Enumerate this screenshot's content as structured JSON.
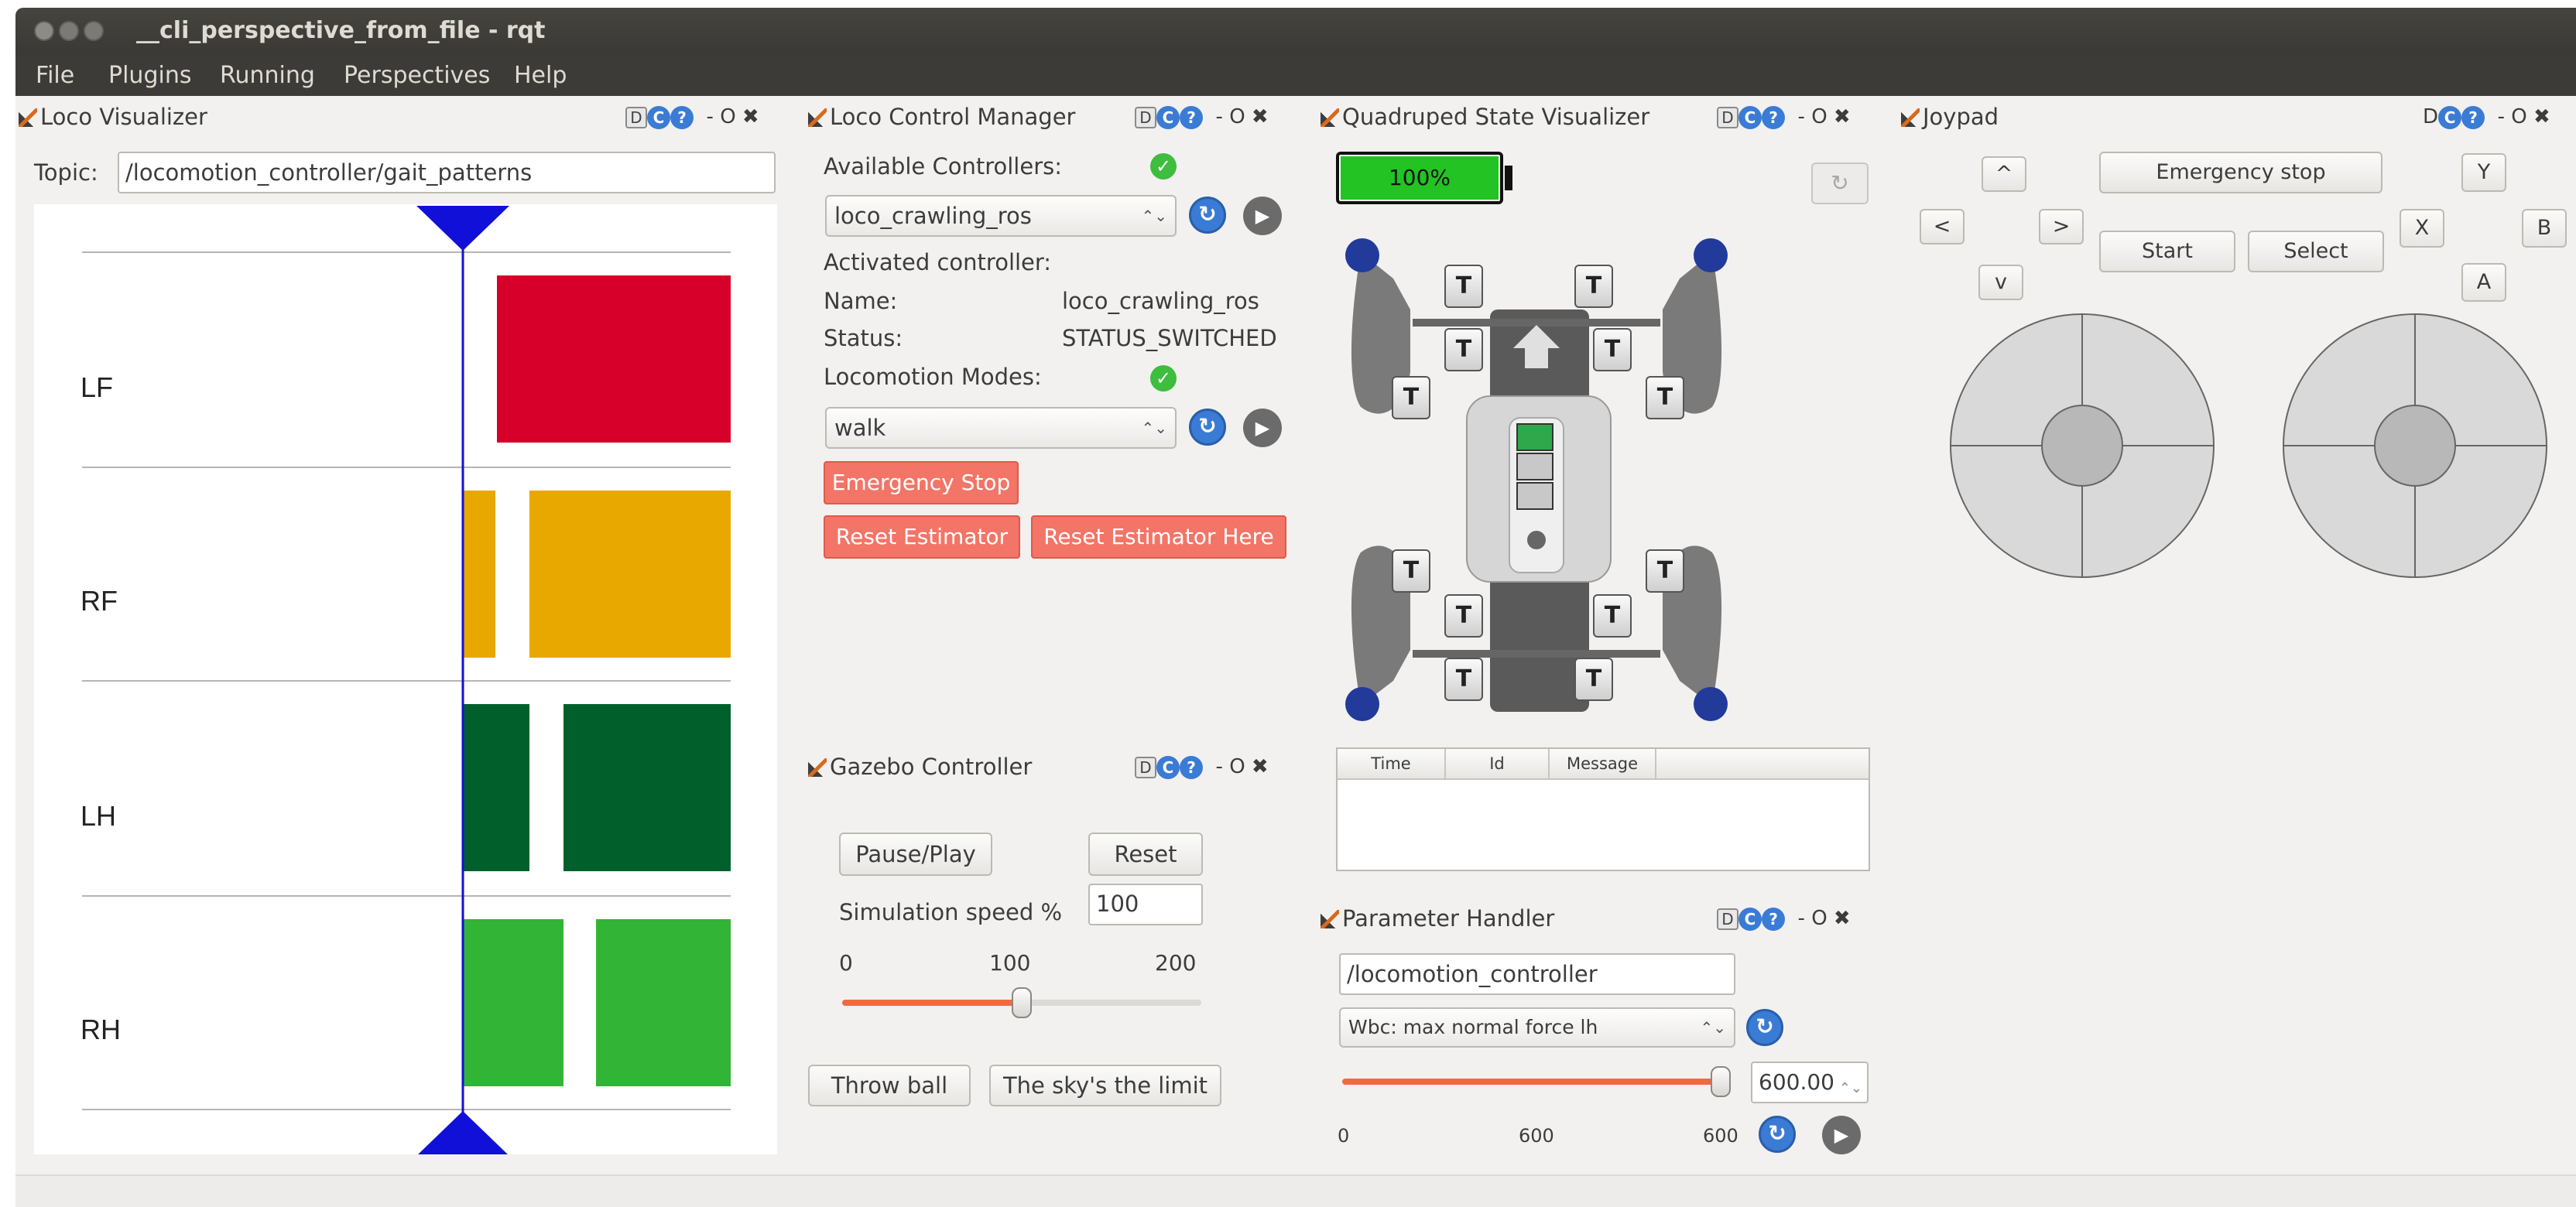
{
  "window": {
    "title": "__cli_perspective_from_file - rqt"
  },
  "menu": [
    "File",
    "Plugins",
    "Running",
    "Perspectives",
    "Help"
  ],
  "panel_controls": {
    "d": "D",
    "dash": "-",
    "o": "O",
    "x": "✖"
  },
  "colors": {
    "lf": "#d6002a",
    "rf": "#e8a800",
    "lh": "#005f2b",
    "rh": "#32b537",
    "cursor": "#1010d8",
    "red_button": "#f27567",
    "slider": "#ef6b3f"
  },
  "loco_visualizer": {
    "title": "Loco Visualizer",
    "topic_label": "Topic:",
    "topic_value": "/locomotion_controller/gait_patterns",
    "legs": [
      "LF",
      "RF",
      "LH",
      "RH"
    ]
  },
  "loco_control_manager": {
    "title": "Loco Control Manager",
    "available_label": "Available Controllers:",
    "controller_selected": "loco_crawling_ros",
    "activated_label": "Activated controller:",
    "name_label": "Name:",
    "name_value": "loco_crawling_ros",
    "status_label": "Status:",
    "status_value": "STATUS_SWITCHED",
    "modes_label": "Locomotion Modes:",
    "mode_selected": "walk",
    "emergency_stop": "Emergency Stop",
    "reset_estimator": "Reset Estimator",
    "reset_estimator_here": "Reset Estimator Here"
  },
  "quadruped_state": {
    "title": "Quadruped State Visualizer",
    "battery": "100%",
    "battery_level": 1.0,
    "leg_marker": "T",
    "table_headers": [
      "Time",
      "Id",
      "Message"
    ]
  },
  "joypad": {
    "title": "Joypad",
    "up": "^",
    "down": "v",
    "left": "<",
    "right": ">",
    "emergency_stop": "Emergency stop",
    "start": "Start",
    "select": "Select",
    "y": "Y",
    "x": "X",
    "b": "B",
    "a": "A"
  },
  "gazebo": {
    "title": "Gazebo Controller",
    "pause_play": "Pause/Play",
    "reset": "Reset",
    "speed_label": "Simulation speed %",
    "speed_value": "100",
    "tick_min": "0",
    "tick_mid": "100",
    "tick_max": "200",
    "slider_value": 100,
    "throw_ball": "Throw ball",
    "sky_limit": "The sky's the limit"
  },
  "parameter_handler": {
    "title": "Parameter Handler",
    "namespace": "/locomotion_controller",
    "parameter": "Wbc: max normal force lh",
    "value": "600.00",
    "tick_min": "0",
    "tick_mid": "600",
    "tick_max": "600"
  }
}
